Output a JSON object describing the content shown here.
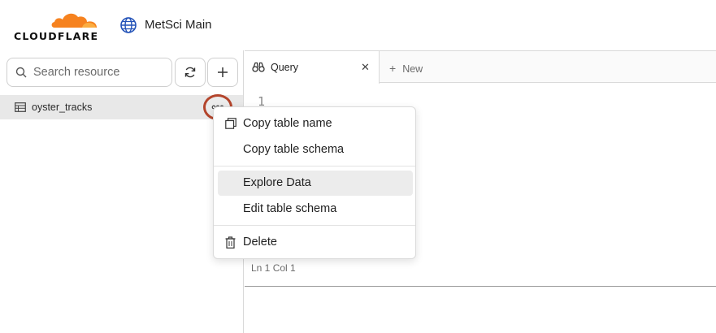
{
  "brand": {
    "name": "CLOUDFLARE",
    "accent": "#f6821f"
  },
  "account": {
    "name": "MetSci Main"
  },
  "sidebar": {
    "search_placeholder": "Search resource",
    "tables": [
      {
        "name": "oyster_tracks"
      }
    ]
  },
  "tabs": [
    {
      "label": "Query"
    }
  ],
  "new_tab_label": "New",
  "editor": {
    "line_number": "1",
    "status": "Ln 1 Col 1"
  },
  "context_menu": {
    "items": [
      {
        "label": "Copy table name",
        "icon": "copy-icon"
      },
      {
        "label": "Copy table schema"
      },
      {
        "label": "Explore Data"
      },
      {
        "label": "Edit table schema"
      },
      {
        "label": "Delete",
        "icon": "trash-icon"
      }
    ]
  },
  "highlight_color": "#b4452c"
}
